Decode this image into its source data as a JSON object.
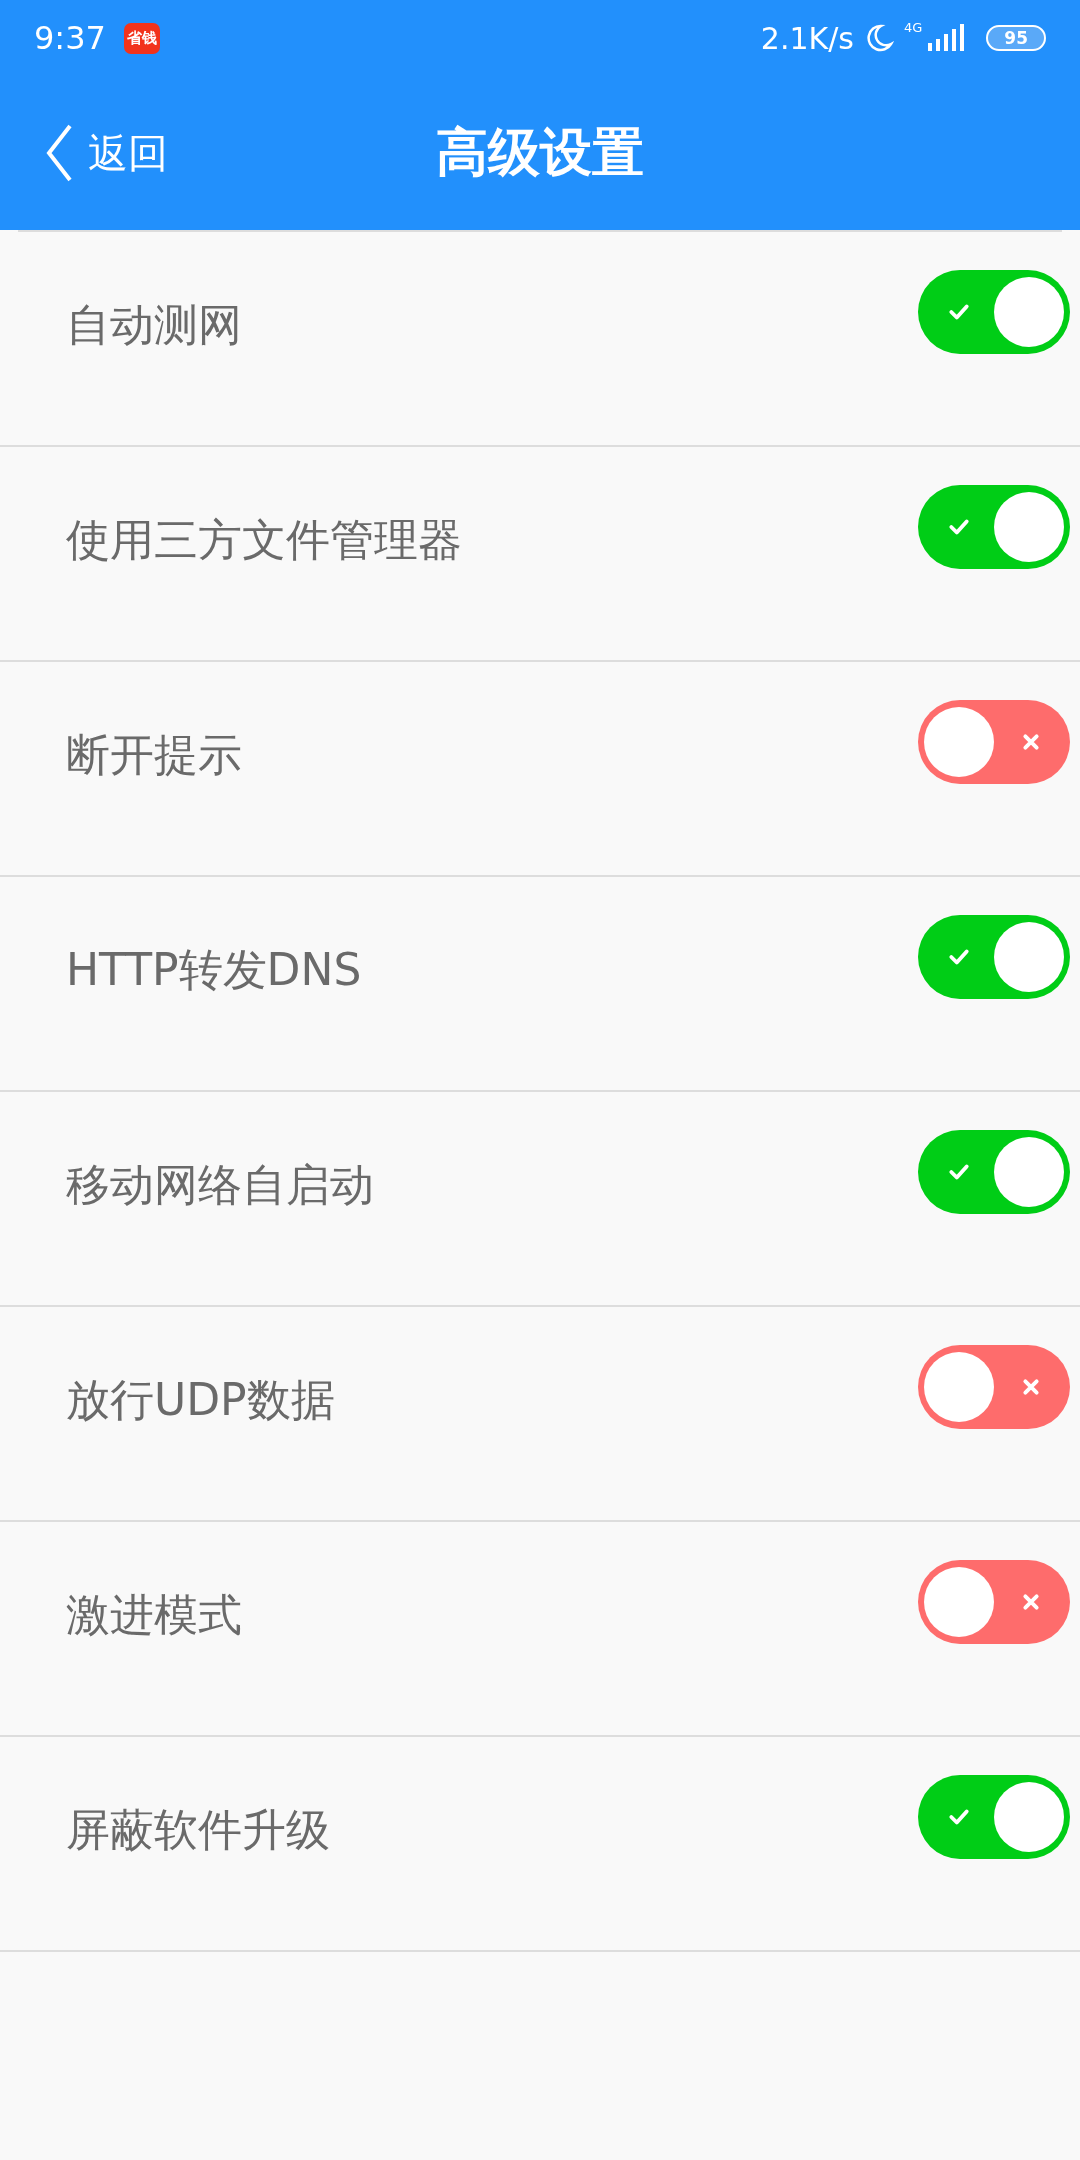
{
  "status_bar": {
    "time": "9:37",
    "app_badge": "省钱",
    "net_speed": "2.1K/s",
    "network": "4G",
    "battery": "95"
  },
  "header": {
    "back": "返回",
    "title": "高级设置"
  },
  "settings": [
    {
      "label": "自动测网",
      "on": true
    },
    {
      "label": "使用三方文件管理器",
      "on": true
    },
    {
      "label": "断开提示",
      "on": false
    },
    {
      "label": "HTTP转发DNS",
      "on": true
    },
    {
      "label": "移动网络自启动",
      "on": true
    },
    {
      "label": "放行UDP数据",
      "on": false
    },
    {
      "label": "激进模式",
      "on": false
    },
    {
      "label": "屏蔽软件升级",
      "on": true
    }
  ]
}
